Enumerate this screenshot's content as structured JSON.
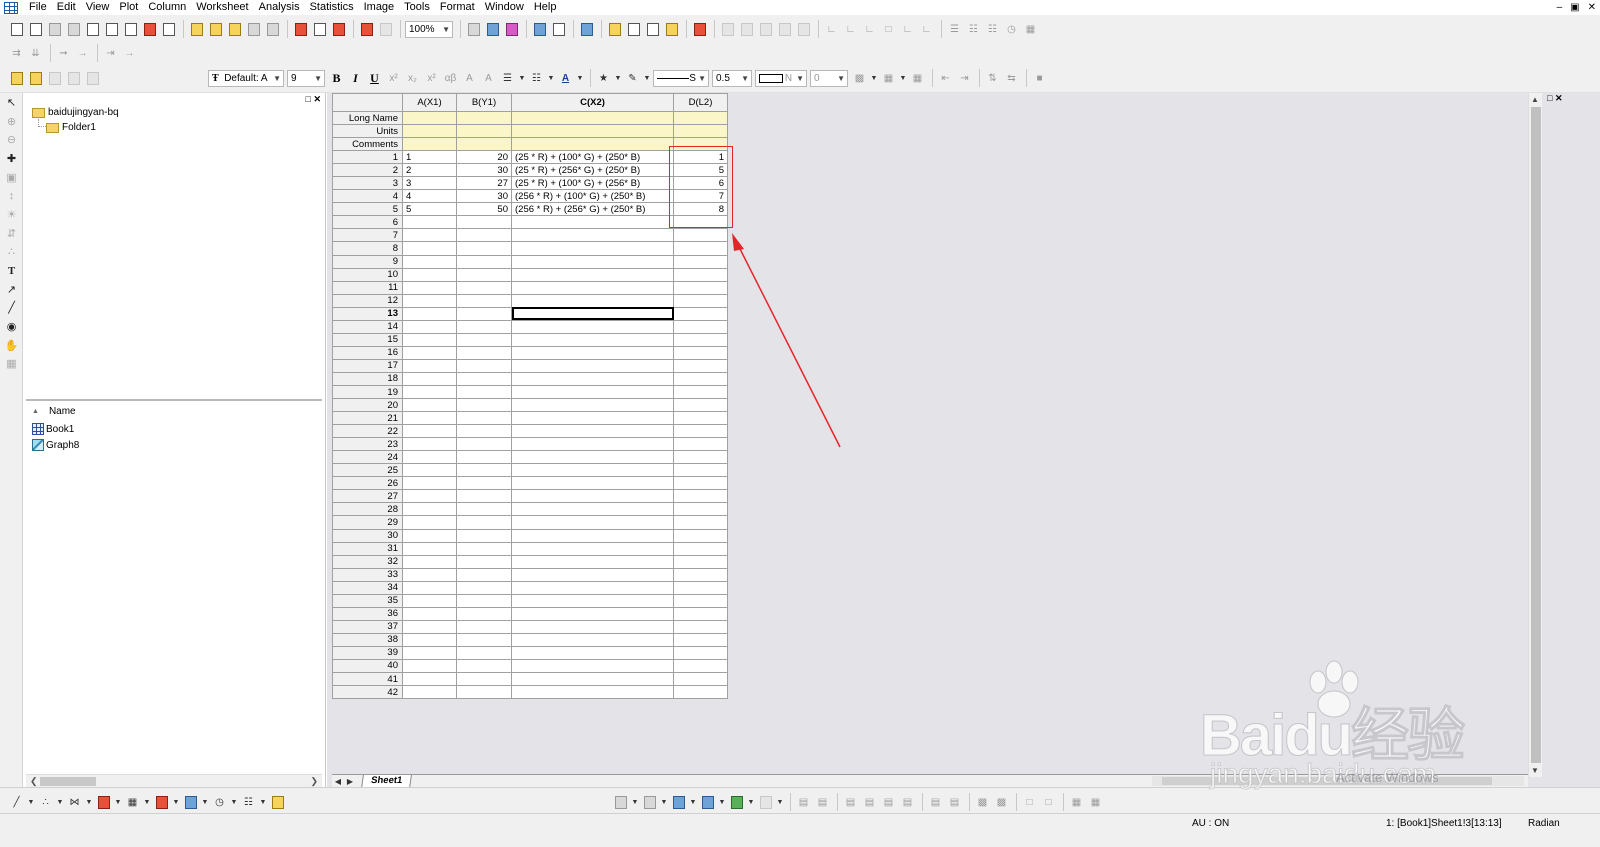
{
  "menubar": {
    "items": [
      "File",
      "Edit",
      "View",
      "Plot",
      "Column",
      "Worksheet",
      "Analysis",
      "Statistics",
      "Image",
      "Tools",
      "Format",
      "Window",
      "Help"
    ]
  },
  "toolbar": {
    "zoom": "100%",
    "font_name": "Default: A",
    "font_size": "9",
    "bold": "B",
    "italic": "I",
    "underline": "U",
    "line_style": "S",
    "line_width": "0.5",
    "border_value": "N",
    "pattern_value": "0"
  },
  "explorer": {
    "root_folder": "baidujingyan-bq",
    "sub_folder": "Folder1",
    "list_header": "Name",
    "items": [
      {
        "name": "Book1",
        "icon": "workbook-icon"
      },
      {
        "name": "Graph8",
        "icon": "graph-icon"
      }
    ]
  },
  "sheet": {
    "columns": [
      "A(X1)",
      "B(Y1)",
      "C(X2)",
      "D(L2)"
    ],
    "meta_rows": [
      "Long Name",
      "Units",
      "Comments"
    ],
    "rows": [
      {
        "n": "1",
        "a": "1",
        "b": "20",
        "c": "(25 * R) + (100* G) + (250* B)",
        "d": "1"
      },
      {
        "n": "2",
        "a": "2",
        "b": "30",
        "c": "(25 * R) + (256* G) + (250* B)",
        "d": "5"
      },
      {
        "n": "3",
        "a": "3",
        "b": "27",
        "c": "(25 * R) + (100* G) + (256* B)",
        "d": "6"
      },
      {
        "n": "4",
        "a": "4",
        "b": "30",
        "c": "(256 * R) + (100* G) + (250* B)",
        "d": "7"
      },
      {
        "n": "5",
        "a": "5",
        "b": "50",
        "c": "(256 * R) + (256* G) + (250* B)",
        "d": "8"
      }
    ],
    "empty_row_numbers": [
      "6",
      "7",
      "8",
      "9",
      "10",
      "11",
      "12",
      "13",
      "14",
      "15",
      "16",
      "17",
      "18",
      "19",
      "20",
      "21",
      "22",
      "23",
      "24",
      "25",
      "26",
      "27",
      "28",
      "29",
      "30",
      "31",
      "32",
      "33",
      "34",
      "35",
      "36",
      "37",
      "38",
      "39",
      "40",
      "41",
      "42"
    ],
    "active_row": "13",
    "sheet_tab": "Sheet1"
  },
  "status": {
    "au": "AU : ON",
    "cell_ref": "1: [Book1]Sheet1!3[13:13]",
    "angle": "Radian"
  },
  "watermark": {
    "logo": "Baidu经验",
    "url": "jingyan.baidu.com",
    "activate": "Activate Windows"
  },
  "colors": {
    "highlight": "#e2262a",
    "meta_row_bg": "#fbf6c8",
    "workspace_bg": "#e3e3e8"
  }
}
